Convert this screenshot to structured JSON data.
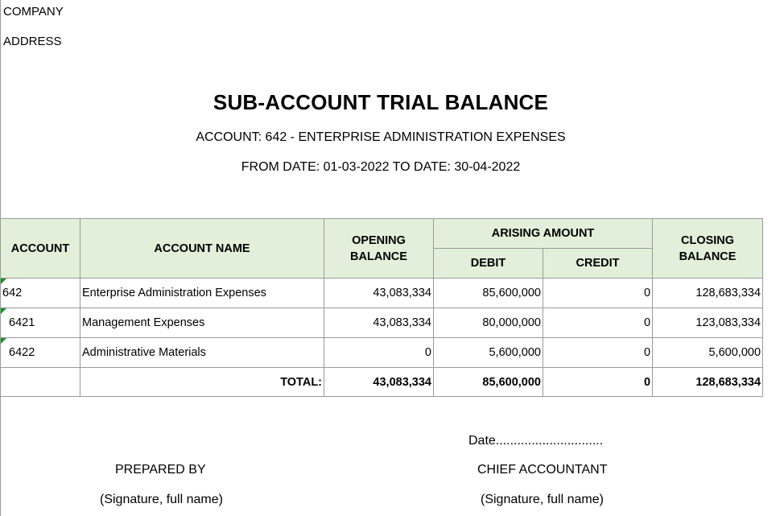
{
  "header": {
    "company": "COMPANY",
    "address": "ADDRESS",
    "title": "SUB-ACCOUNT TRIAL BALANCE",
    "account_line": "ACCOUNT: 642 - ENTERPRISE ADMINISTRATION EXPENSES",
    "date_line": "FROM DATE: 01-03-2022 TO DATE: 30-04-2022"
  },
  "table": {
    "headers": {
      "account": "ACCOUNT",
      "account_name": "ACCOUNT NAME",
      "opening_balance": "OPENING BALANCE",
      "arising_amount": "ARISING AMOUNT",
      "debit": "DEBIT",
      "credit": "CREDIT",
      "closing_balance": "CLOSING BALANCE"
    },
    "rows": [
      {
        "account": "642",
        "name": "Enterprise Administration Expenses",
        "opening": "43,083,334",
        "debit": "85,600,000",
        "credit": "0",
        "closing": "128,683,334"
      },
      {
        "account": "6421",
        "name": "Management Expenses",
        "opening": "43,083,334",
        "debit": "80,000,000",
        "credit": "0",
        "closing": "123,083,334"
      },
      {
        "account": "6422",
        "name": "Administrative Materials",
        "opening": "0",
        "debit": "5,600,000",
        "credit": "0",
        "closing": "5,600,000"
      }
    ],
    "total": {
      "label": "TOTAL:",
      "opening": "43,083,334",
      "debit": "85,600,000",
      "credit": "0",
      "closing": "128,683,334"
    }
  },
  "signatures": {
    "date": "Date..............................",
    "prepared_by": "PREPARED BY",
    "chief_accountant": "CHIEF ACCOUNTANT",
    "signature_note_left": "(Signature, full name)",
    "signature_note_right": "(Signature, full name)"
  },
  "colors": {
    "header_fill": "#e2efda",
    "grid": "#9a9a9a",
    "comment_marker": "#1e8a2e"
  }
}
